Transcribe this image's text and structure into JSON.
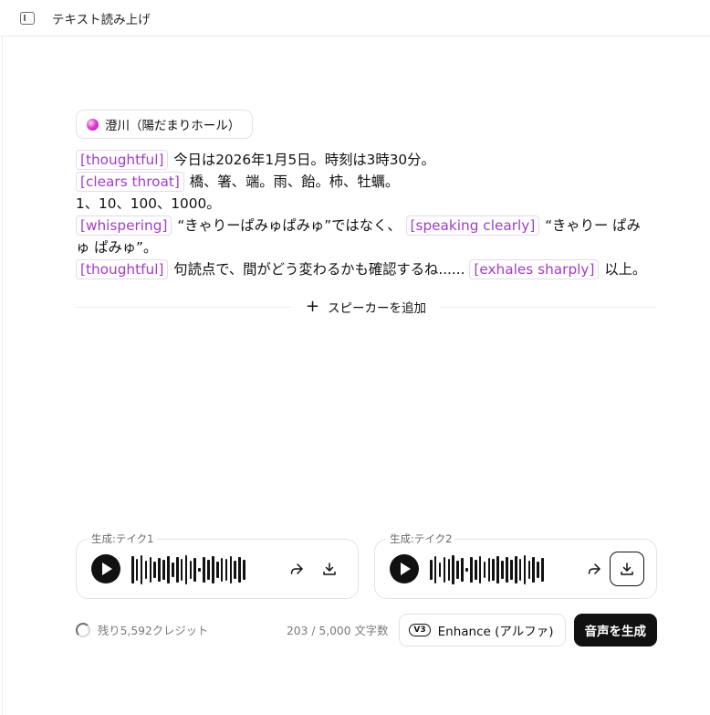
{
  "header": {
    "title": "テキスト読み上げ"
  },
  "speaker": {
    "name": "澄川（陽だまりホール）"
  },
  "editor": {
    "line1": {
      "tag": "[thoughtful]",
      "text": "今日は2026年1月5日。時刻は3時30分。"
    },
    "line2": {
      "tag": "[clears throat]",
      "text": "橋、箸、端。雨、飴。柿、牡蠣。"
    },
    "line3": {
      "text": "1、10、100、1000。"
    },
    "line4": {
      "tag1": "[whispering]",
      "text1": "“きゃりーぱみゅぱみゅ”ではなく、",
      "tag2": "[speaking clearly]",
      "text2": "“きゃりー ぱみ"
    },
    "line5": {
      "text": "ゅ ぱみゅ”。"
    },
    "line6": {
      "tag1": "[thoughtful]",
      "text1": "句読点で、間がどう変わるかも確認するね......",
      "tag2": "[exhales sharply]",
      "text2": "以上。"
    }
  },
  "add_speaker": {
    "label": "スピーカーを追加"
  },
  "takes": [
    {
      "label": "生成:テイク1"
    },
    {
      "label": "生成:テイク2"
    }
  ],
  "footer": {
    "credits": "残り5,592クレジット",
    "char_count": "203 / 5,000 文字数",
    "enhance_badge": "V3",
    "enhance_label": "Enhance (アルファ)",
    "generate_label": "音声を生成"
  },
  "colors": {
    "tag_text": "#a23cc8",
    "primary_button": "#111111"
  },
  "icons": [
    "sidebar-toggle-icon",
    "voice-orb-icon",
    "plus-icon",
    "play-icon",
    "share-icon",
    "download-icon",
    "credits-ring-icon"
  ]
}
